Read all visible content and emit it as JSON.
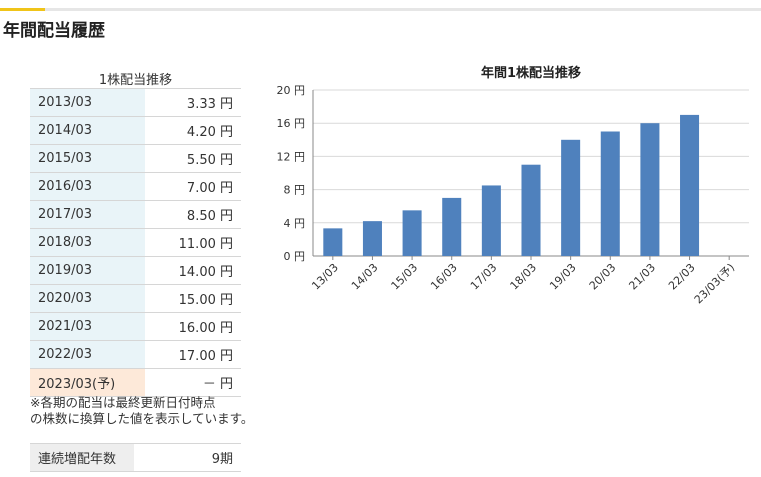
{
  "section": {
    "title": "年間配当履歴"
  },
  "table": {
    "caption": "1株配当推移",
    "unit": "円",
    "rows": [
      {
        "period": "2013/03",
        "amount": "3.33"
      },
      {
        "period": "2014/03",
        "amount": "4.20"
      },
      {
        "period": "2015/03",
        "amount": "5.50"
      },
      {
        "period": "2016/03",
        "amount": "7.00"
      },
      {
        "period": "2017/03",
        "amount": "8.50"
      },
      {
        "period": "2018/03",
        "amount": "11.00"
      },
      {
        "period": "2019/03",
        "amount": "14.00"
      },
      {
        "period": "2020/03",
        "amount": "15.00"
      },
      {
        "period": "2021/03",
        "amount": "16.00"
      },
      {
        "period": "2022/03",
        "amount": "17.00"
      },
      {
        "period": "2023/03(予)",
        "amount": "－"
      }
    ]
  },
  "note": {
    "line1": "※各期の配当は最終更新日付時点",
    "line2": "の株数に換算した値を表示しています。"
  },
  "streak": {
    "label": "連続増配年数",
    "value": "9期"
  },
  "colors": {
    "bar": "#4f81bd",
    "forecast_row": "#fde9d9",
    "period_cell": "#e9f4f8",
    "accent": "#f0c419"
  },
  "chart_data": {
    "type": "bar",
    "title": "年間1株配当推移",
    "categories": [
      "13/03",
      "14/03",
      "15/03",
      "16/03",
      "17/03",
      "18/03",
      "19/03",
      "20/03",
      "21/03",
      "22/03",
      "23/03(予)"
    ],
    "values": [
      3.33,
      4.2,
      5.5,
      7.0,
      8.5,
      11.0,
      14.0,
      15.0,
      16.0,
      17.0,
      null
    ],
    "ylim": [
      0,
      20
    ],
    "yticks": [
      0,
      4,
      8,
      12,
      16,
      20
    ],
    "ytick_suffix": " 円",
    "grid": true
  }
}
